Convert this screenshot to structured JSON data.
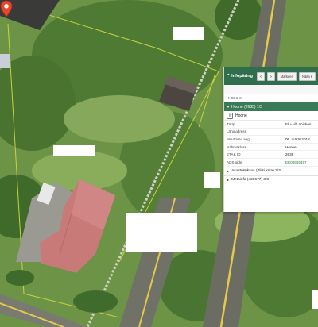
{
  "panel": {
    "title": "Infopäring",
    "buttons": [
      "<",
      ">",
      "Markeeri",
      "Näita k"
    ],
    "height_text": "H: 93.5 m",
    "section_title": "Hoone (2635) 1/3",
    "sub_title": "Hoone",
    "rows": [
      {
        "key": "Tüüp",
        "value": "Elu- või ühiskon"
      },
      {
        "key": "Lähiaadress",
        "value": ""
      },
      {
        "key": "Muutmise aeg",
        "value": "06. märts 2018."
      },
      {
        "key": "Nähtusklass",
        "value": "Hoone"
      },
      {
        "key": "ETAK ID",
        "value": "2635"
      },
      {
        "key": "ADS oide",
        "value": "EE00865457"
      }
    ],
    "groups": [
      {
        "label": "Asustusüksus (Tiilsi küla) 2/3"
      },
      {
        "label": "Metainfo (429677) 3/3"
      }
    ]
  },
  "colors": {
    "panel_header": "#2f6f4e",
    "section_header": "#3b7a58",
    "link": "#2b7a3f",
    "marker": "#e8472b",
    "roof": "#c87a78"
  },
  "icons": {
    "title_icon": "chevron-up-icon",
    "section_icon": "triangle-down-icon",
    "info_icon": "info-icon",
    "marker": "map-pin-icon"
  }
}
